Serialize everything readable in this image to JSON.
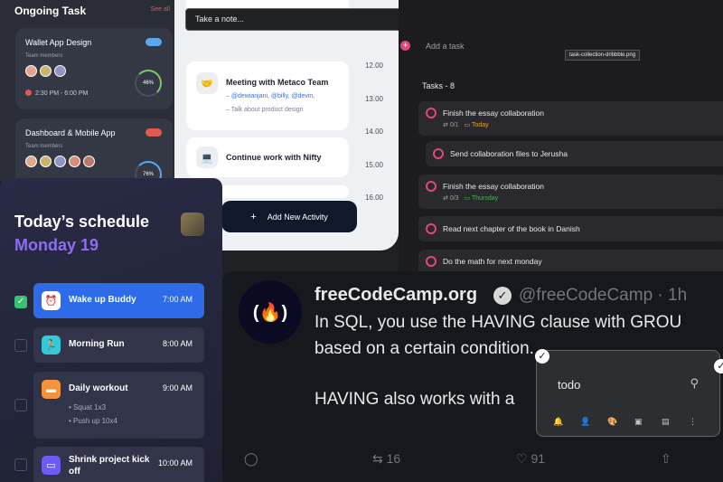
{
  "ongoing": {
    "title": "Ongoing Task",
    "see_all": "See all",
    "cards": [
      {
        "title": "Wallet App Design",
        "members_label": "Team members",
        "time": "2:30 PM - 6:00 PM",
        "progress": "46%",
        "badge_color": "#5aa7f0"
      },
      {
        "title": "Dashboard & Mobile App",
        "members_label": "Team members",
        "time": "",
        "progress": "76%",
        "badge_color": "#e05a4f"
      }
    ]
  },
  "note_bar": {
    "placeholder": "Take a note..."
  },
  "activities": {
    "cards": [
      {
        "title": "Meeting with Metaco Team",
        "mentions": "@dewianjani, @billy, @devin,",
        "note": "Talk about product design",
        "icon": "handshake-icon"
      },
      {
        "title": "Continue work with Nifty",
        "icon": "laptop-icon"
      }
    ],
    "hours": [
      "12.00",
      "13.00",
      "14.00",
      "15.00",
      "16.00"
    ],
    "add_button": "Add New Activity"
  },
  "tasks": {
    "add_task": "Add a task",
    "tooltip": "task-collection-dribbble.png",
    "count_label": "Tasks - 8",
    "items": [
      {
        "title": "Finish the essay collaboration",
        "sub": "0/1",
        "due": "Today",
        "due_kind": "today"
      },
      {
        "title": "Send collaboration files to Jerusha"
      },
      {
        "title": "Finish the essay collaboration",
        "sub": "0/3",
        "due": "Thursday",
        "due_kind": "later"
      },
      {
        "title": "Read next chapter of the book in Danish"
      },
      {
        "title": "Do the math for next monday"
      }
    ]
  },
  "schedule": {
    "title": "Today’s schedule",
    "date": "Monday 19",
    "items": [
      {
        "label": "Wake up Buddy",
        "time": "7:00 AM",
        "done": true,
        "icon": "alarm-clock-icon",
        "icon_color": "#ffffff"
      },
      {
        "label": "Morning Run",
        "time": "8:00 AM",
        "done": false,
        "icon": "running-icon",
        "icon_color": "#35c8d8"
      },
      {
        "label": "Daily workout",
        "time": "9:00 AM",
        "done": false,
        "icon": "dumbbell-icon",
        "icon_color": "#f3933b",
        "subs": [
          "Squat 1x3",
          "Push up 10x4"
        ]
      },
      {
        "label": "Shrink  project kick off",
        "time": "10:00 AM",
        "done": false,
        "icon": "monitor-icon",
        "icon_color": "#6c5cf5"
      }
    ]
  },
  "tweet": {
    "name": "freeCodeCamp.org",
    "handle": "@freeCodeCamp · 1h",
    "line1": "In SQL, you use the HAVING clause with GROU",
    "line2": "based on a certain condition.",
    "line3": "HAVING also works with a",
    "retweets": "16",
    "likes": "91"
  },
  "todo_card": {
    "title": "todo"
  }
}
